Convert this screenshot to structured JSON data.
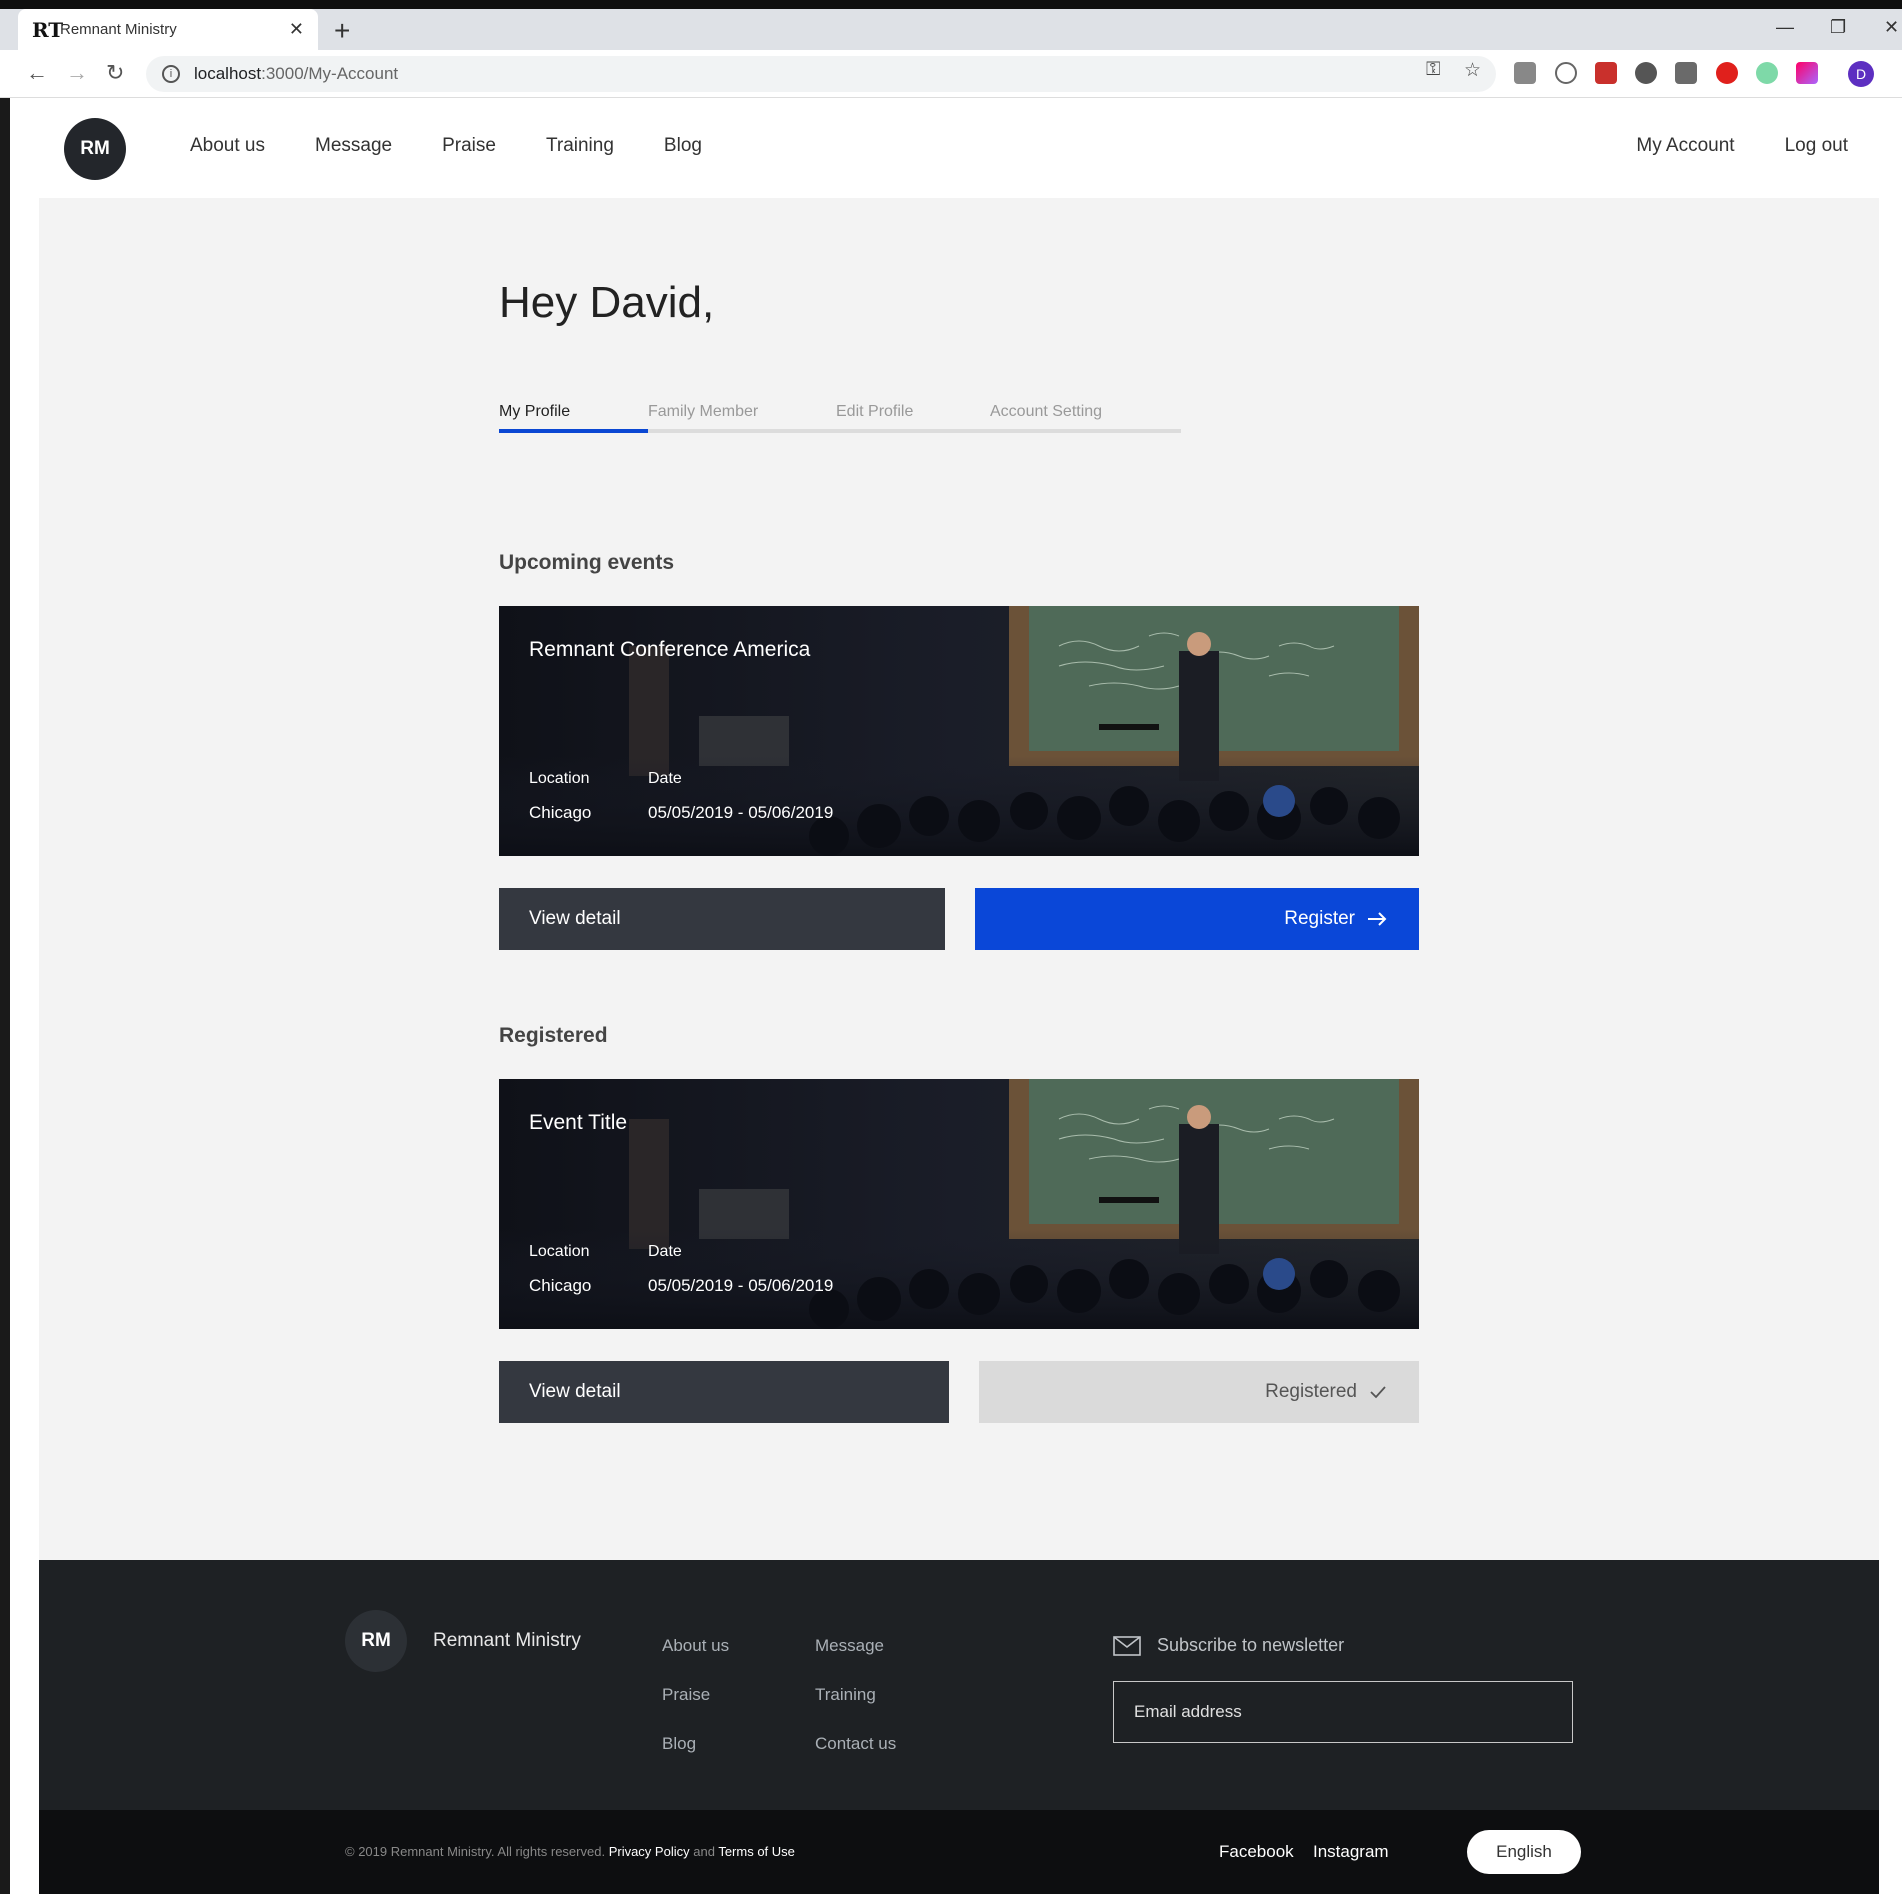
{
  "browser": {
    "tab_title": "Remnant Ministry",
    "tab_favicon": "RT",
    "tab_close": "✕",
    "new_tab": "+",
    "url_host": "localhost",
    "url_path": ":3000/My-Account",
    "profile_initial": "D"
  },
  "header": {
    "logo": "RM",
    "nav": [
      "About us",
      "Message",
      "Praise",
      "Training",
      "Blog"
    ],
    "my_account": "My Account",
    "log_out": "Log out"
  },
  "main": {
    "greeting": "Hey David,",
    "tabs": [
      "My Profile",
      "Family Member",
      "Edit Profile",
      "Account Setting"
    ],
    "active_tab": "My Profile",
    "upcoming_title": "Upcoming events",
    "registered_title": "Registered",
    "upcoming_event": {
      "title": "Remnant Conference America",
      "location_label": "Location",
      "location": "Chicago",
      "date_label": "Date",
      "date": "05/05/2019 - 05/06/2019",
      "view_label": "View detail",
      "action_label": "Register"
    },
    "registered_event": {
      "title": "Event Title",
      "location_label": "Location",
      "location": "Chicago",
      "date_label": "Date",
      "date": "05/05/2019 - 05/06/2019",
      "view_label": "View detail",
      "action_label": "Registered"
    }
  },
  "footer": {
    "logo": "RM",
    "brand": "Remnant Ministry",
    "links_col1": [
      "About us",
      "Praise",
      "Blog"
    ],
    "links_col2": [
      "Message",
      "Training",
      "Contact us"
    ],
    "newsletter_label": "Subscribe to newsletter",
    "email_placeholder": "Email address",
    "copyright": "© 2019 Remnant Ministry. All rights reserved.",
    "privacy": "Privacy Policy",
    "and": "and",
    "terms": "Terms of Use",
    "facebook": "Facebook",
    "instagram": "Instagram",
    "language": "English"
  },
  "colors": {
    "accent": "#0a47d8",
    "dark_button": "#343840",
    "footer_bg": "#1e2124"
  }
}
